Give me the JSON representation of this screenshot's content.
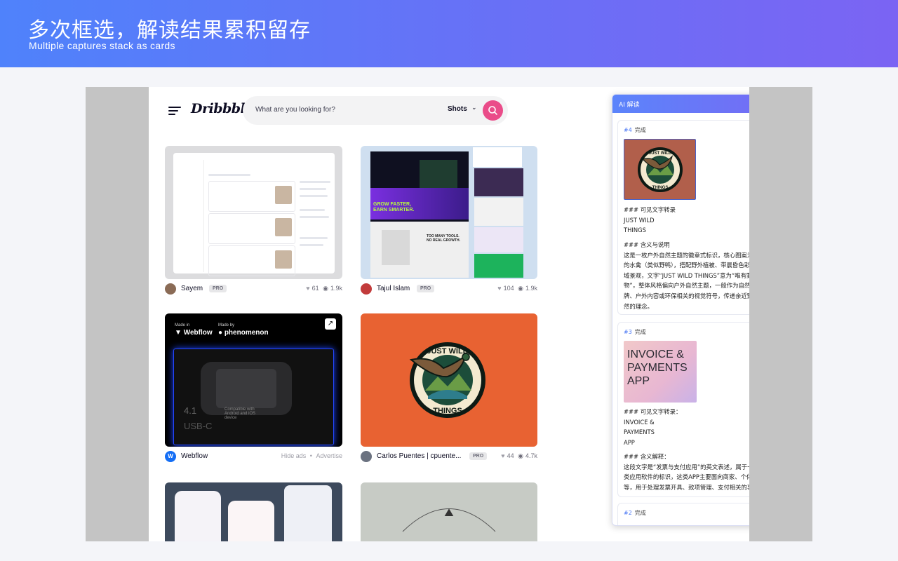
{
  "banner": {
    "title": "多次框选，解读结果累积留存",
    "subtitle": "Multiple captures stack as cards"
  },
  "dribbble": {
    "logo": "Dribbble",
    "search_placeholder": "What are you looking for?",
    "search_filter": "Shots"
  },
  "shots": [
    {
      "author": "Sayem",
      "badge": "PRO",
      "likes": "61",
      "views": "1.9k"
    },
    {
      "author": "Tajul Islam",
      "badge": "PRO",
      "likes": "104",
      "views": "1.9k"
    },
    {
      "author": "Webflow",
      "hide_ads": "Hide ads",
      "advertise": "Advertise"
    },
    {
      "author": "Carlos Puentes | cpuente...",
      "badge": "PRO",
      "likes": "44",
      "views": "4.7k"
    }
  ],
  "webflow_ad": {
    "made_in": "Made in",
    "made_by": "Made by",
    "brand": "Webflow",
    "partner": "phenomenon",
    "model": "4.1",
    "port": "USB-C",
    "compat": "Compatible with Android and iOS device"
  },
  "invoice_thumb": "INVOICE &\nPAYMENTS\nAPP",
  "panel": {
    "title": "AI 解读",
    "minimize": "—",
    "close": "x",
    "cards": [
      {
        "id": "#4",
        "status": "完成",
        "text1": "### 可见文字转录\nJUST WILD\nTHINGS",
        "text2": "### 含义与说明\n这是一枚户外自然主题的徽章式标识，核心图案为飞行\n的水禽（类似野鸭），搭配野外植被、带晨昏色彩的水\n域景观，文字“JUST WILD THINGS”意为“唯有野生事\n物”，整体风格偏向户外自然主题，一般作为自然相关品\n牌、户外内容或环保相关的视觉符号，传递亲近野生自\n然的理念。"
      },
      {
        "id": "#3",
        "status": "完成",
        "text1": "### 可见文字转录：\nINVOICE &\nPAYMENTS\nAPP",
        "text2": "### 含义解释：\n这段文字是“发票与支付应用”的英文表述，属于一款商用\n类应用软件的标识，这类APP主要面向商家、个体从业者\n等，用于处理发票开具、款项管理、支付相关的事务。"
      },
      {
        "id": "#2",
        "status": "完成"
      }
    ]
  },
  "colors": {
    "accent": "#5b84fb",
    "dribbble_pink": "#ea4c89",
    "status_blue": "#4b78f5"
  }
}
